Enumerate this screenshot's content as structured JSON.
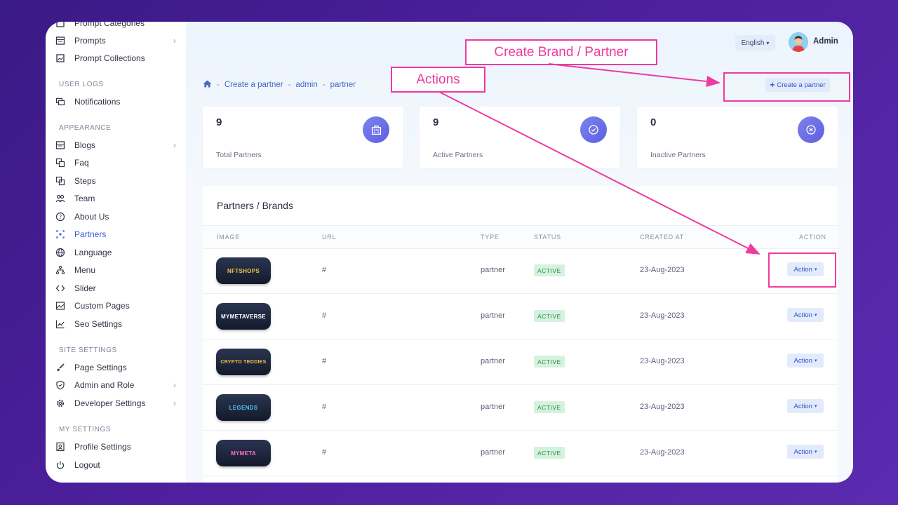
{
  "sidebar": {
    "items": [
      {
        "label": "Prompt Categories",
        "icon": "grid-icon"
      },
      {
        "label": "Prompts",
        "icon": "table-icon",
        "chevron": "›"
      },
      {
        "label": "Prompt Collections",
        "icon": "gallery-icon"
      },
      {
        "label": "Notifications",
        "icon": "chat-icon"
      },
      {
        "label": "Blogs",
        "icon": "table-icon",
        "chevron": "›"
      },
      {
        "label": "Faq",
        "icon": "faq-icon"
      },
      {
        "label": "Steps",
        "icon": "steps-icon"
      },
      {
        "label": "Team",
        "icon": "team-icon"
      },
      {
        "label": "About Us",
        "icon": "info-icon"
      },
      {
        "label": "Partners",
        "icon": "partners-icon"
      },
      {
        "label": "Language",
        "icon": "globe-icon"
      },
      {
        "label": "Menu",
        "icon": "sitemap-icon"
      },
      {
        "label": "Slider",
        "icon": "code-icon"
      },
      {
        "label": "Custom Pages",
        "icon": "image-icon"
      },
      {
        "label": "Seo Settings",
        "icon": "chart-icon"
      },
      {
        "label": "Page Settings",
        "icon": "brush-icon"
      },
      {
        "label": "Admin and Role",
        "icon": "shield-icon",
        "chevron": "›"
      },
      {
        "label": "Developer Settings",
        "icon": "gear-icon",
        "chevron": "›"
      },
      {
        "label": "Profile Settings",
        "icon": "user-card-icon"
      },
      {
        "label": "Logout",
        "icon": "power-icon"
      }
    ],
    "sections": {
      "user_logs": "USER LOGS",
      "appearance": "APPEARANCE",
      "site_settings": "SITE SETTINGS",
      "my_settings": "MY SETTINGS"
    },
    "active_item": "Partners"
  },
  "header": {
    "language": "English",
    "language_caret": "▾",
    "admin_name": "Admin"
  },
  "breadcrumb": {
    "home_icon": "home-icon",
    "separator": "-",
    "items": [
      "Create a partner",
      "admin",
      "partner"
    ]
  },
  "create_button": {
    "icon": "+",
    "label": "Create a partner"
  },
  "stats": [
    {
      "value": "9",
      "label": "Total Partners",
      "icon": "building-icon"
    },
    {
      "value": "9",
      "label": "Active Partners",
      "icon": "check-circle-icon"
    },
    {
      "value": "0",
      "label": "Inactive Partners",
      "icon": "x-circle-icon"
    }
  ],
  "table": {
    "title": "Partners / Brands",
    "columns": [
      "IMAGE",
      "URL",
      "TYPE",
      "STATUS",
      "CREATED AT",
      "ACTION"
    ],
    "rows": [
      {
        "logo": "NFTSHOPS",
        "url": "#",
        "type": "partner",
        "status": "ACTIVE",
        "created": "23-Aug-2023",
        "action": "Action"
      },
      {
        "logo": "MYMETAVERSE",
        "url": "#",
        "type": "partner",
        "status": "ACTIVE",
        "created": "23-Aug-2023",
        "action": "Action"
      },
      {
        "logo": "CRYPTO TEDDIES",
        "url": "#",
        "type": "partner",
        "status": "ACTIVE",
        "created": "23-Aug-2023",
        "action": "Action"
      },
      {
        "logo": "LEGENDS",
        "url": "#",
        "type": "partner",
        "status": "ACTIVE",
        "created": "23-Aug-2023",
        "action": "Action"
      },
      {
        "logo": "MYMETA",
        "url": "#",
        "type": "partner",
        "status": "ACTIVE",
        "created": "23-Aug-2023",
        "action": "Action"
      }
    ],
    "action_caret": "▾"
  },
  "annotations": {
    "create_label": "Create Brand / Partner",
    "actions_label": "Actions",
    "color": "#ef3aa0"
  },
  "colors": {
    "accent": "#3d5bd9",
    "badge": "#6a6ae6",
    "status_bg": "#d5f2de",
    "status_text": "#2b8a4a",
    "background": "#4a1f9a"
  }
}
